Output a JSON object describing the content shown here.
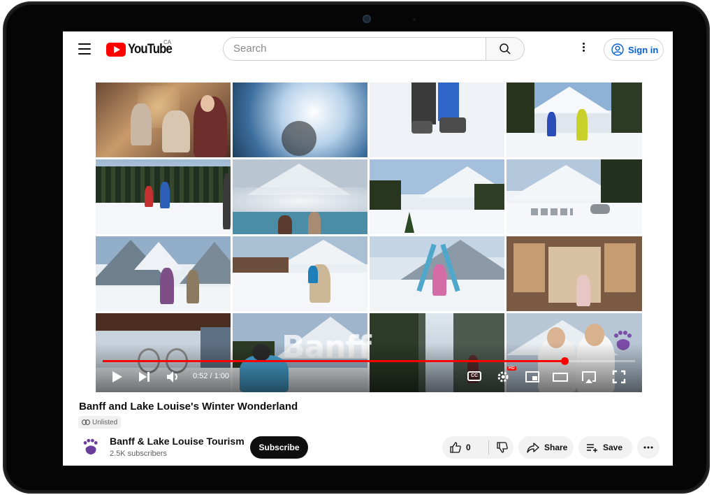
{
  "header": {
    "logo_text": "YouTube",
    "country_code": "CA",
    "search_placeholder": "Search",
    "signin_label": "Sign in"
  },
  "player": {
    "watermark": "Banff",
    "current_time": "0:52",
    "duration": "1:00",
    "time_display": "0:52 / 1:00",
    "progress_fraction": 0.867,
    "cc_label": "CC",
    "hd_badge": "HD"
  },
  "video": {
    "title": "Banff and Lake Louise's Winter Wonderland",
    "visibility": "Unlisted"
  },
  "channel": {
    "name": "Banff & Lake Louise Tourism",
    "subscribers": "2.5K subscribers",
    "subscribe_label": "Subscribe"
  },
  "actions": {
    "like_count": "0",
    "share_label": "Share",
    "save_label": "Save"
  },
  "colors": {
    "brand_red": "#ff0000",
    "link_blue": "#065fd4",
    "text": "#0f0f0f"
  }
}
